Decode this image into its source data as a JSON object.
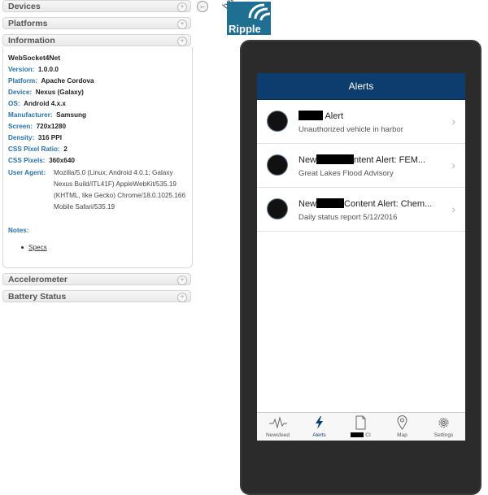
{
  "left_panel": {
    "sections_top": [
      {
        "label": "Devices"
      },
      {
        "label": "Platforms"
      },
      {
        "label": "Information"
      }
    ],
    "info": {
      "name": "WebSocket4Net",
      "rows": [
        {
          "key": "Version:",
          "value": "1.0.0.0"
        },
        {
          "key": "Platform:",
          "value": "Apache Cordova"
        },
        {
          "key": "Device:",
          "value": "Nexus (Galaxy)"
        },
        {
          "key": "OS:",
          "value": "Android 4.x.x"
        },
        {
          "key": "Manufacturer:",
          "value": "Samsung"
        },
        {
          "key": "Screen:",
          "value": "720x1280"
        },
        {
          "key": "Density:",
          "value": "316 PPI"
        },
        {
          "key": "CSS Pixel Ratio:",
          "value": "2"
        },
        {
          "key": "CSS Pixels:",
          "value": "360x640"
        }
      ],
      "user_agent_key": "User Agent:",
      "user_agent_value": "Mozilla/5.0 (Linux; Android 4.0.1; Galaxy Nexus Build/ITL41F) AppleWebKit/535.19 (KHTML, like Gecko) Chrome/18.0.1025.166 Mobile Safari/535.19",
      "notes_key": "Notes:",
      "specs_link": "Specs"
    },
    "sections_bottom": [
      {
        "label": "Accelerometer"
      },
      {
        "label": "Battery Status"
      }
    ],
    "plus_glyph": "+",
    "collapse_glyph": "←"
  },
  "logo": {
    "beta": "beta",
    "brand": "Ripple"
  },
  "app": {
    "header_title": "Alerts",
    "alerts": [
      {
        "title_suffix": " Alert",
        "subtitle": "Unauthorized vehicle in harbor"
      },
      {
        "title_prefix": "New",
        "title_suffix": "ntent Alert: FEM...",
        "subtitle": "Great Lakes Flood Advisory"
      },
      {
        "title_prefix": "New",
        "title_suffix": "Content Alert: Chem...",
        "subtitle": "Daily status report 5/12/2016"
      }
    ],
    "chevron": "›",
    "tabs": [
      {
        "label": "Newsfeed",
        "icon": "pulse-icon"
      },
      {
        "label": "Alerts",
        "icon": "lightning-icon"
      },
      {
        "label": "CI",
        "icon": "document-icon"
      },
      {
        "label": "Map",
        "icon": "map-pin-icon"
      },
      {
        "label": "Settings",
        "icon": "gear-icon"
      }
    ],
    "colors": {
      "header": "#0c3d6e",
      "tab_active": "#0c3d6e"
    }
  }
}
